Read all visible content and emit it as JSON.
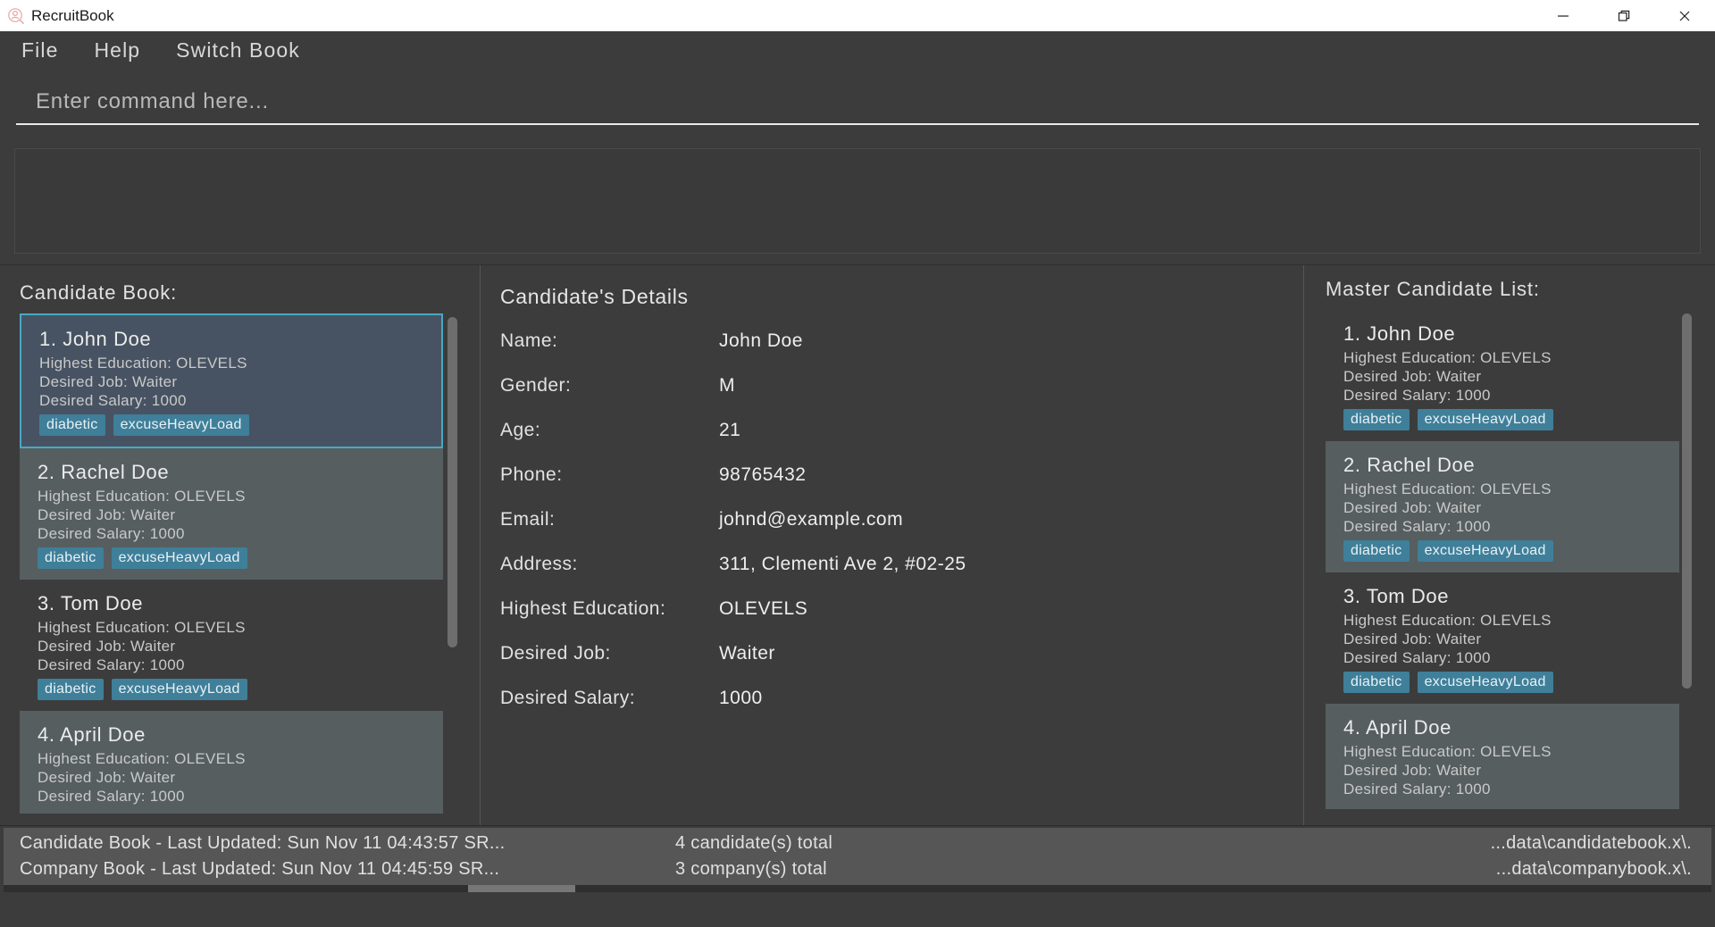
{
  "window": {
    "title": "RecruitBook",
    "app_icon": "person-search-icon",
    "controls": [
      {
        "name": "minimize-button",
        "glyph": "minimize-icon"
      },
      {
        "name": "maximize-button",
        "glyph": "restore-icon"
      },
      {
        "name": "close-button",
        "glyph": "close-icon"
      }
    ]
  },
  "menu": {
    "items": [
      {
        "label": "File"
      },
      {
        "label": "Help"
      },
      {
        "label": "Switch Book"
      }
    ]
  },
  "command": {
    "placeholder": "Enter command here...",
    "value": ""
  },
  "result": {
    "text": ""
  },
  "left_panel": {
    "heading": "Candidate Book:",
    "items": [
      {
        "index": "1.",
        "name": "John Doe",
        "education": "Highest Education:  OLEVELS",
        "job": "Desired Job:  Waiter",
        "salary": "Desired Salary: 1000",
        "tags": [
          "diabetic",
          "excuseHeavyLoad"
        ],
        "state": "selected"
      },
      {
        "index": "2.",
        "name": "Rachel Doe",
        "education": "Highest Education:  OLEVELS",
        "job": "Desired Job:  Waiter",
        "salary": "Desired Salary: 1000",
        "tags": [
          "diabetic",
          "excuseHeavyLoad"
        ],
        "state": "alt"
      },
      {
        "index": "3.",
        "name": "Tom Doe",
        "education": "Highest Education:  OLEVELS",
        "job": "Desired Job:  Waiter",
        "salary": "Desired Salary: 1000",
        "tags": [
          "diabetic",
          "excuseHeavyLoad"
        ],
        "state": "norm"
      },
      {
        "index": "4.",
        "name": "April Doe",
        "education": "Highest Education:  OLEVELS",
        "job": "Desired Job:  Waiter",
        "salary": "Desired Salary: 1000",
        "tags": [],
        "state": "alt"
      }
    ]
  },
  "details": {
    "heading": "Candidate's Details",
    "rows": [
      {
        "label": "Name:",
        "value": "John Doe"
      },
      {
        "label": "Gender:",
        "value": "M"
      },
      {
        "label": "Age:",
        "value": "21"
      },
      {
        "label": "Phone:",
        "value": "98765432"
      },
      {
        "label": "Email:",
        "value": "johnd@example.com"
      },
      {
        "label": "Address:",
        "value": "311, Clementi Ave 2, #02-25"
      },
      {
        "label": "Highest Education:",
        "value": "OLEVELS"
      },
      {
        "label": "Desired Job:",
        "value": "Waiter"
      },
      {
        "label": "Desired Salary:",
        "value": "1000"
      }
    ]
  },
  "right_panel": {
    "heading": "Master Candidate List:",
    "items": [
      {
        "index": "1.",
        "name": "John Doe",
        "education": "Highest Education:  OLEVELS",
        "job": "Desired Job:  Waiter",
        "salary": "Desired Salary: 1000",
        "tags": [
          "diabetic",
          "excuseHeavyLoad"
        ],
        "state": "norm"
      },
      {
        "index": "2.",
        "name": "Rachel Doe",
        "education": "Highest Education:  OLEVELS",
        "job": "Desired Job:  Waiter",
        "salary": "Desired Salary: 1000",
        "tags": [
          "diabetic",
          "excuseHeavyLoad"
        ],
        "state": "alt"
      },
      {
        "index": "3.",
        "name": "Tom Doe",
        "education": "Highest Education:  OLEVELS",
        "job": "Desired Job:  Waiter",
        "salary": "Desired Salary: 1000",
        "tags": [
          "diabetic",
          "excuseHeavyLoad"
        ],
        "state": "norm"
      },
      {
        "index": "4.",
        "name": "April Doe",
        "education": "Highest Education:  OLEVELS",
        "job": "Desired Job:  Waiter",
        "salary": "Desired Salary: 1000",
        "tags": [],
        "state": "alt"
      }
    ]
  },
  "statusbar": {
    "left_lines": [
      "Candidate Book - Last Updated: Sun Nov 11 04:43:57 SR...",
      "Company Book - Last Updated: Sun Nov 11 04:45:59 SR..."
    ],
    "mid_lines": [
      "4 candidate(s) total",
      "3 company(s) total"
    ],
    "right_lines": [
      "...data\\candidatebook.x\\.",
      "...data\\companybook.x\\."
    ]
  },
  "colors": {
    "window_chrome": "#ffffff",
    "app_background": "#3c3c3c",
    "selection": "#475362",
    "selection_border": "#4aa7c4",
    "alt_row": "#565e60",
    "tag": "#3f7f99",
    "status_bar": "#565656",
    "text_primary": "#ececec",
    "text_secondary": "#c9c9c9"
  }
}
